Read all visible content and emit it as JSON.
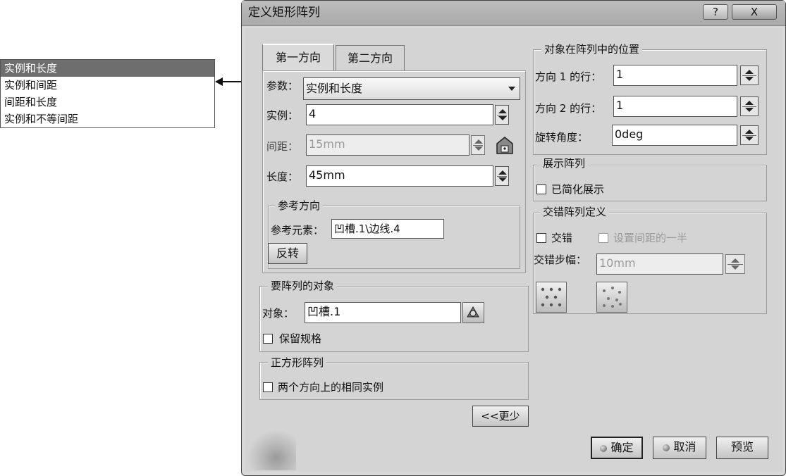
{
  "dropdown_list": {
    "items": [
      "实例和长度",
      "实例和间距",
      "间距和长度",
      "实例和不等间距"
    ],
    "selected_index": 0
  },
  "dialog": {
    "title": "定义矩形阵列",
    "help_label": "?",
    "close_label": "X"
  },
  "tabs": [
    "第一方向",
    "第二方向"
  ],
  "first_direction": {
    "param_label": "参数：",
    "param_value": "实例和长度",
    "instance_label": "实例：",
    "instance_value": "4",
    "spacing_label": "间距：",
    "spacing_value": "15mm",
    "length_label": "长度：",
    "length_value": "45mm",
    "ref_direction_legend": "参考方向",
    "ref_element_label": "参考元素：",
    "ref_element_value": "凹槽.1\\边线.4",
    "reverse_button": "反转"
  },
  "objects_to_pattern": {
    "legend": "要阵列的对象",
    "object_label": "对象：",
    "object_value": "凹槽.1",
    "keep_spec_label": "保留规格"
  },
  "square_pattern": {
    "legend": "正方形阵列",
    "same_instances_label": "两个方向上的相同实例"
  },
  "less_button": "<<更少",
  "position": {
    "legend": "对象在阵列中的位置",
    "row_dir1_label": "方向 1 的行：",
    "row_dir1_value": "1",
    "row_dir2_label": "方向 2 的行：",
    "row_dir2_value": "1",
    "rotation_label": "旋转角度：",
    "rotation_value": "0deg"
  },
  "show_pattern": {
    "legend": "展示阵列",
    "simplified_label": "已简化展示"
  },
  "staggered": {
    "legend": "交错阵列定义",
    "stagger_label": "交错",
    "half_spacing_label": "设置间距的一半",
    "step_label": "交错步幅：",
    "step_value": "10mm"
  },
  "footer": {
    "ok": "确定",
    "cancel": "取消",
    "preview": "预览"
  },
  "colors": {
    "dialog_bg": "#d4d4d4",
    "selected_item_bg": "#6e6e6e"
  }
}
